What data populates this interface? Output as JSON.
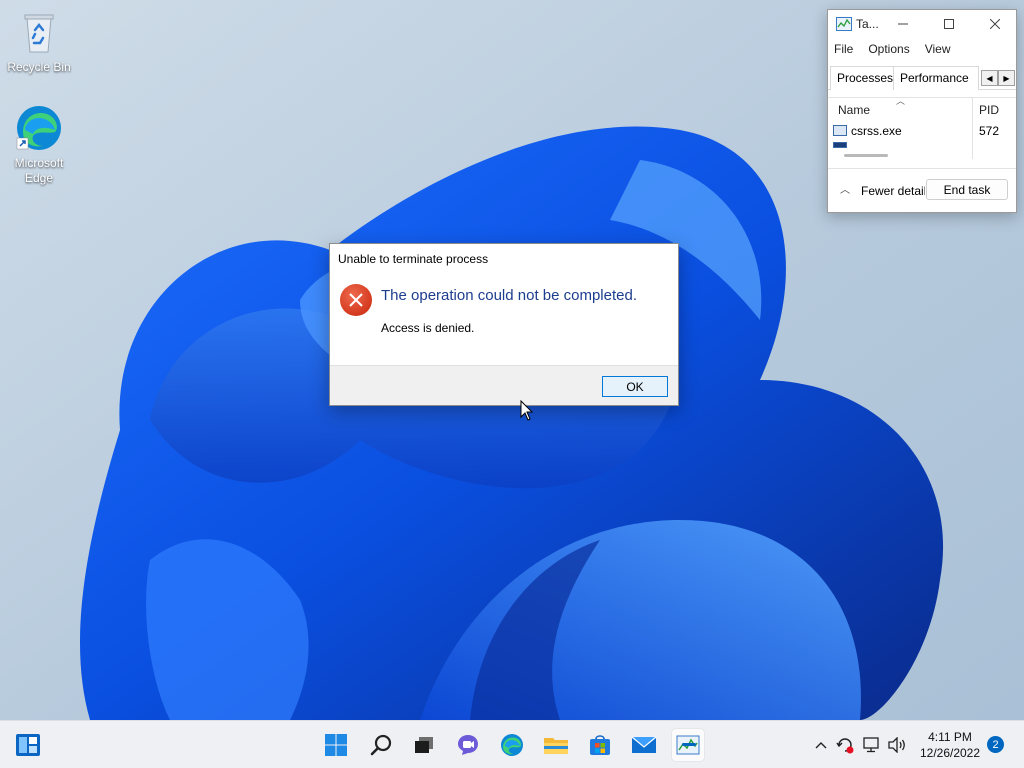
{
  "desktop": {
    "icons": [
      {
        "label": "Recycle Bin",
        "icon": "recycle-bin-icon"
      },
      {
        "label": "Microsoft Edge",
        "icon": "edge-icon"
      }
    ]
  },
  "task_manager": {
    "title": "Ta...",
    "menu": [
      "File",
      "Options",
      "View"
    ],
    "tabs": [
      "Processes",
      "Performance"
    ],
    "columns": [
      "Name",
      "PID"
    ],
    "rows": [
      {
        "name": "csrss.exe",
        "pid": "572"
      }
    ],
    "fewer_details": "Fewer detail",
    "end_task": "End task"
  },
  "dialog": {
    "title": "Unable to terminate process",
    "main_message": "The operation could not be completed.",
    "sub_message": "Access is denied.",
    "ok_label": "OK",
    "icon": "error-icon"
  },
  "taskbar": {
    "apps": [
      "widgets-icon",
      "start-icon",
      "search-icon",
      "task-view-icon",
      "chat-icon",
      "edge-icon",
      "file-explorer-icon",
      "store-icon",
      "mail-icon",
      "task-manager-icon"
    ],
    "time": "4:11 PM",
    "date": "12/26/2022",
    "notification_count": "2"
  },
  "colors": {
    "accent": "#0067c0",
    "error": "#d4391e",
    "dialog_heading": "#1d3d8f"
  }
}
